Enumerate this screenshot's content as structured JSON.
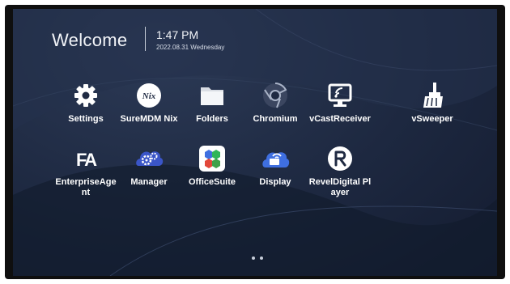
{
  "home": {
    "welcome": "Welcome",
    "time": "1:47 PM",
    "date": "2022.08.31 Wednesday"
  },
  "apps": [
    {
      "label": "Settings",
      "icon": "gear-icon"
    },
    {
      "label": "SureMDM Nix",
      "icon": "suremdm-nix-icon",
      "badge": "Nix"
    },
    {
      "label": "Folders",
      "icon": "folder-icon"
    },
    {
      "label": "Chromium",
      "icon": "chromium-icon"
    },
    {
      "label": "vCastReceiver",
      "icon": "vcast-receiver-icon"
    },
    {
      "label": "vSweeper",
      "icon": "broom-icon"
    },
    {
      "label": "EnterpriseAgent",
      "icon": "enterprise-agent-icon",
      "badge": "FA"
    },
    {
      "label": "Manager",
      "icon": "manager-gears-icon"
    },
    {
      "label": "OfficeSuite",
      "icon": "officesuite-icon"
    },
    {
      "label": "Display",
      "icon": "display-icon"
    },
    {
      "label": "RevelDigital Player",
      "icon": "reveldigital-icon"
    }
  ],
  "pager": {
    "pages": 2,
    "current": 1
  },
  "colors": {
    "background": "#1d2840",
    "text": "#ffffff",
    "manager_blue": "#3a55c8",
    "display_blue": "#3f6fe0"
  }
}
